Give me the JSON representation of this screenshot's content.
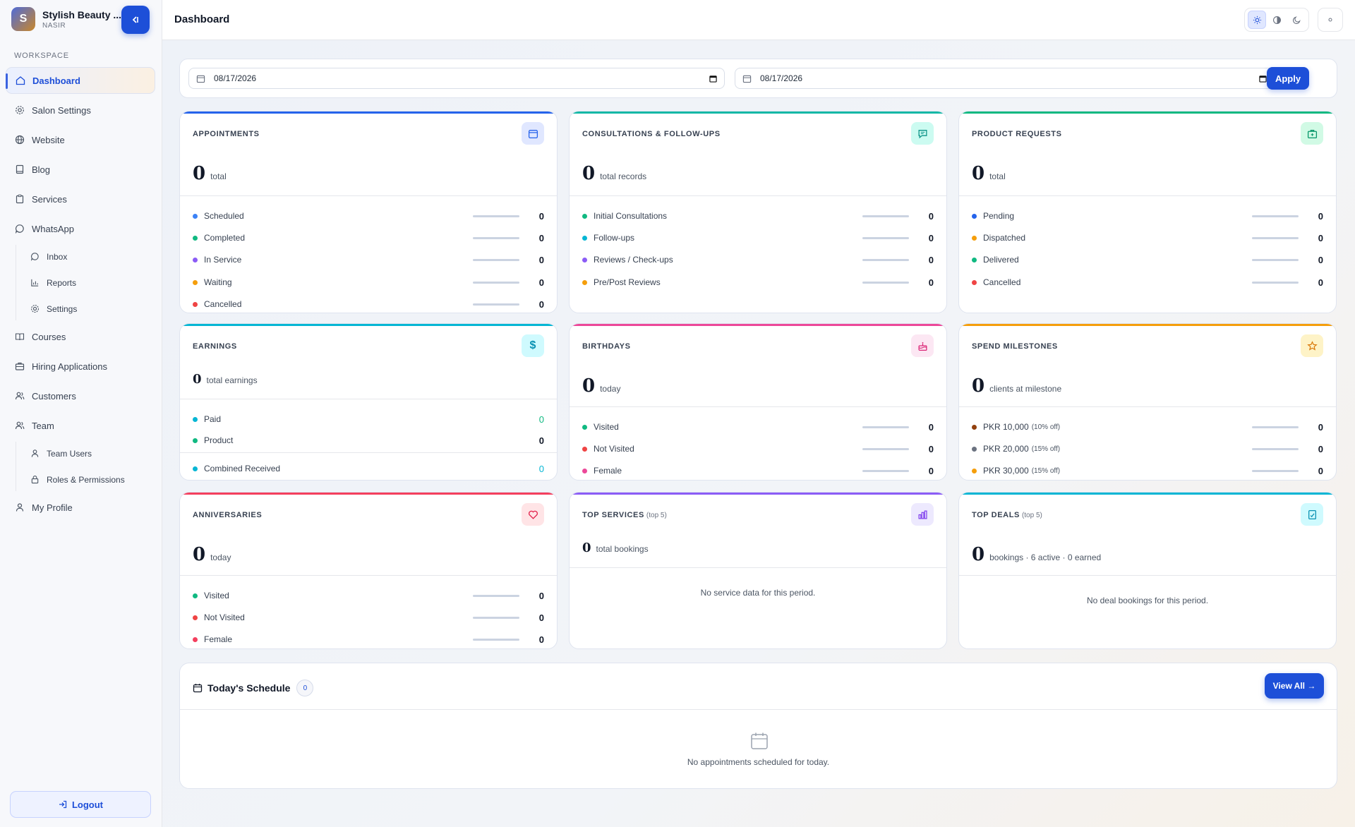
{
  "brand": {
    "initial": "S",
    "name": "Stylish Beauty ...",
    "sub": "NASIR"
  },
  "sidebar": {
    "section_label": "WORKSPACE",
    "items": [
      {
        "label": "Dashboard",
        "icon": "home-icon"
      },
      {
        "label": "Salon Settings",
        "icon": "gear-icon"
      },
      {
        "label": "Website",
        "icon": "globe-icon"
      },
      {
        "label": "Blog",
        "icon": "book-icon"
      },
      {
        "label": "Services",
        "icon": "clipboard-icon"
      },
      {
        "label": "WhatsApp",
        "icon": "chat-icon"
      },
      {
        "label": "Courses",
        "icon": "open-book-icon"
      },
      {
        "label": "Hiring Applications",
        "icon": "briefcase-icon"
      },
      {
        "label": "Customers",
        "icon": "users-icon"
      },
      {
        "label": "Team",
        "icon": "team-icon"
      },
      {
        "label": "My Profile",
        "icon": "user-icon"
      }
    ],
    "whatsapp_sub": [
      {
        "label": "Inbox",
        "icon": "message-icon"
      },
      {
        "label": "Reports",
        "icon": "chart-icon"
      },
      {
        "label": "Settings",
        "icon": "gear-icon"
      }
    ],
    "team_sub": [
      {
        "label": "Team Users",
        "icon": "user-icon"
      },
      {
        "label": "Roles & Permissions",
        "icon": "lock-icon"
      }
    ],
    "logout_label": "Logout"
  },
  "header": {
    "title": "Dashboard"
  },
  "filter": {
    "from": "08/17/2026",
    "to": "08/17/2026",
    "apply_label": "Apply"
  },
  "cards": {
    "appointments": {
      "title": "APPOINTMENTS",
      "total": "0",
      "total_label": "total",
      "accent": "#2563eb",
      "rows": [
        {
          "label": "Scheduled",
          "value": "0",
          "color": "#3b82f6"
        },
        {
          "label": "Completed",
          "value": "0",
          "color": "#10b981"
        },
        {
          "label": "In Service",
          "value": "0",
          "color": "#8b5cf6"
        },
        {
          "label": "Waiting",
          "value": "0",
          "color": "#f59e0b"
        },
        {
          "label": "Cancelled",
          "value": "0",
          "color": "#ef4444"
        }
      ]
    },
    "consultations": {
      "title": "CONSULTATIONS & FOLLOW-UPS",
      "total": "0",
      "total_label": "total records",
      "accent": "#14b8a6",
      "rows": [
        {
          "label": "Initial Consultations",
          "value": "0",
          "color": "#10b981"
        },
        {
          "label": "Follow-ups",
          "value": "0",
          "color": "#06b6d4"
        },
        {
          "label": "Reviews / Check-ups",
          "value": "0",
          "color": "#8b5cf6"
        },
        {
          "label": "Pre/Post Reviews",
          "value": "0",
          "color": "#f59e0b"
        }
      ]
    },
    "products": {
      "title": "PRODUCT REQUESTS",
      "total": "0",
      "total_label": "total",
      "accent": "#10b981",
      "rows": [
        {
          "label": "Pending",
          "value": "0",
          "color": "#2563eb"
        },
        {
          "label": "Dispatched",
          "value": "0",
          "color": "#f59e0b"
        },
        {
          "label": "Delivered",
          "value": "0",
          "color": "#10b981"
        },
        {
          "label": "Cancelled",
          "value": "0",
          "color": "#ef4444"
        }
      ]
    },
    "earnings": {
      "title": "EARNINGS",
      "total": "0",
      "total_label": "total earnings",
      "accent": "#06b6d4",
      "rows": [
        {
          "label": "Paid",
          "value": "0",
          "color": "#06b6d4"
        },
        {
          "label": "Product",
          "value": "0",
          "color": "#10b981"
        }
      ],
      "combined": {
        "label": "Combined Received",
        "value": "0",
        "color": "#06b6d4"
      }
    },
    "birthdays": {
      "title": "BIRTHDAYS",
      "total": "0",
      "total_label": "today",
      "accent": "#ec4899",
      "rows": [
        {
          "label": "Visited",
          "value": "0",
          "color": "#10b981"
        },
        {
          "label": "Not Visited",
          "value": "0",
          "color": "#ef4444"
        },
        {
          "label": "Female",
          "value": "0",
          "color": "#ec4899"
        }
      ]
    },
    "milestones": {
      "title": "SPEND MILESTONES",
      "total": "0",
      "total_label": "clients at milestone",
      "accent": "#f59e0b",
      "rows": [
        {
          "label": "PKR 10,000",
          "tag": "(10% off)",
          "value": "0",
          "color": "#92400e"
        },
        {
          "label": "PKR 20,000",
          "tag": "(15% off)",
          "value": "0",
          "color": "#6b7280"
        },
        {
          "label": "PKR 30,000",
          "tag": "(15% off)",
          "value": "0",
          "color": "#f59e0b"
        }
      ]
    },
    "anniversaries": {
      "title": "ANNIVERSARIES",
      "total": "0",
      "total_label": "today",
      "accent": "#f43f5e",
      "rows": [
        {
          "label": "Visited",
          "value": "0",
          "color": "#10b981"
        },
        {
          "label": "Not Visited",
          "value": "0",
          "color": "#ef4444"
        },
        {
          "label": "Female",
          "value": "0",
          "color": "#f43f5e"
        }
      ]
    },
    "top_services": {
      "title": "TOP SERVICES",
      "qualifier": "(top 5)",
      "total": "0",
      "total_label": "total bookings",
      "accent": "#8b5cf6",
      "empty": "No service data for this period."
    },
    "top_deals": {
      "title": "TOP DEALS",
      "qualifier": "(top 5)",
      "total": "0",
      "total_label": "bookings · 6 active · 0 earned",
      "accent": "#06b6d4",
      "empty": "No deal bookings for this period."
    }
  },
  "schedule": {
    "title": "Today's Schedule",
    "count": "0",
    "view_all_label": "View All →",
    "empty": "No appointments scheduled for today."
  }
}
